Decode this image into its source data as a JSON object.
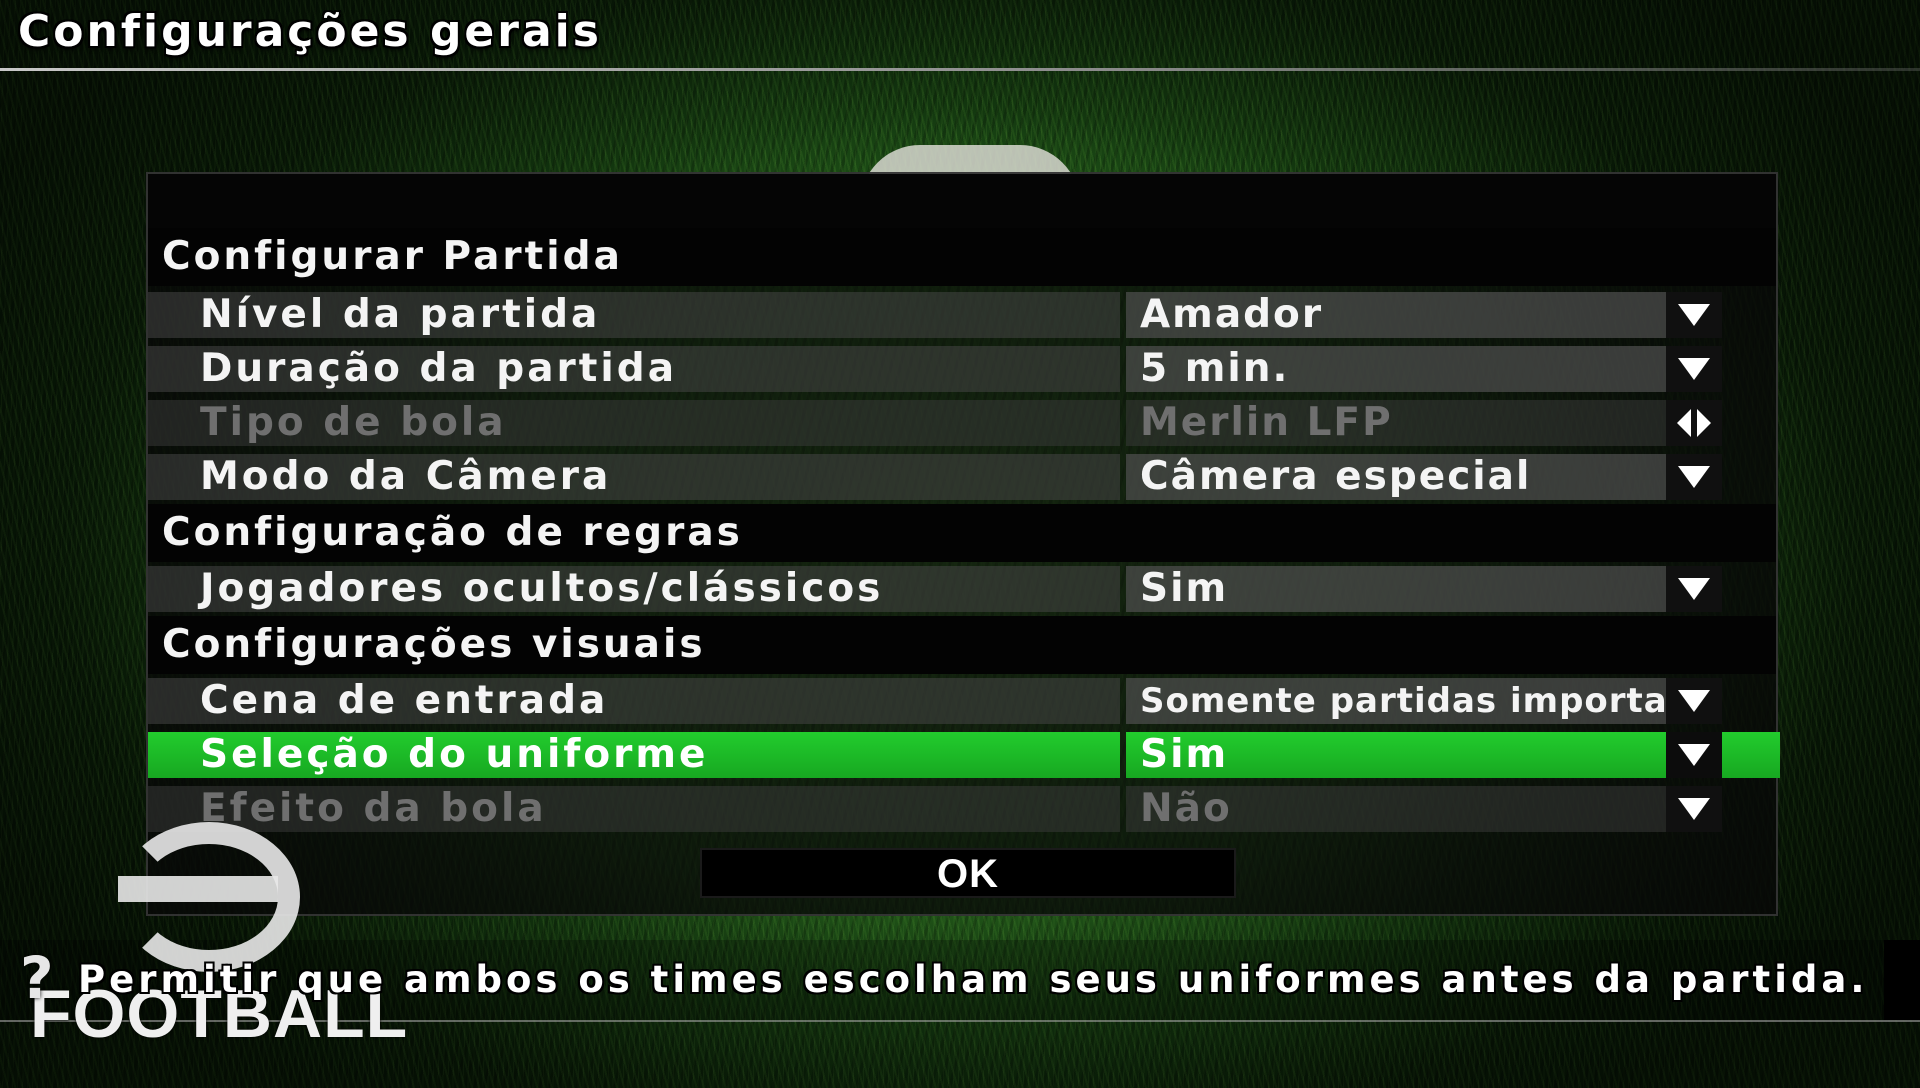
{
  "screen_title": "Configurações gerais",
  "sections": [
    {
      "title": "Configurar Partida",
      "rows": [
        {
          "label": "Nível da partida",
          "value": "Amador",
          "control": "dropdown",
          "state": "normal"
        },
        {
          "label": "Duração da partida",
          "value": "5 min.",
          "control": "dropdown",
          "state": "normal"
        },
        {
          "label": "Tipo de bola",
          "value": "Merlin LFP",
          "control": "left-right",
          "state": "disabled"
        },
        {
          "label": "Modo da Câmera",
          "value": "Câmera especial",
          "control": "dropdown",
          "state": "normal"
        }
      ]
    },
    {
      "title": "Configuração de regras",
      "rows": [
        {
          "label": "Jogadores ocultos/clássicos",
          "value": "Sim",
          "control": "dropdown",
          "state": "normal"
        }
      ]
    },
    {
      "title": "Configurações visuais",
      "rows": [
        {
          "label": "Cena de entrada",
          "value": "Somente partidas importantes",
          "control": "dropdown",
          "state": "normal"
        },
        {
          "label": "Seleção do uniforme",
          "value": "Sim",
          "control": "dropdown",
          "state": "selected"
        },
        {
          "label": "Efeito da bola",
          "value": "Não",
          "control": "dropdown",
          "state": "disabled"
        }
      ]
    }
  ],
  "ok_button": "OK",
  "help": {
    "icon": "?",
    "text": "Permitir que ambos os times escolham seus uniformes antes da partida."
  },
  "logo_text": "FOOTBALL",
  "colors": {
    "selected": "#1fbf2a",
    "panel": "#080808",
    "disabled_text": "#6f6f6f"
  }
}
